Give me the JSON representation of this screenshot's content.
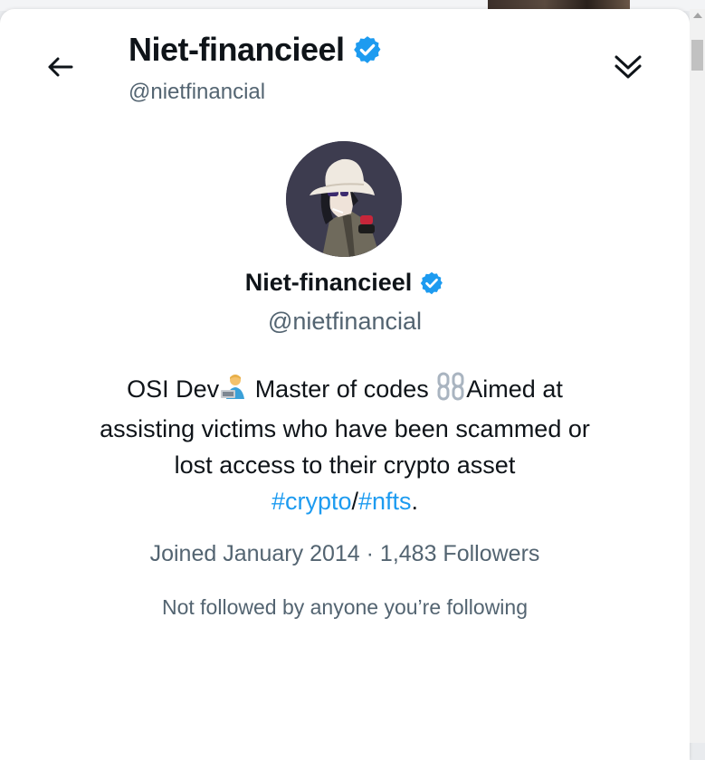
{
  "header": {
    "back_label": "Back",
    "name": "Niet-financieel",
    "handle": "@nietfinancial",
    "collapse_label": "Collapse"
  },
  "profile": {
    "name": "Niet-financieel",
    "handle": "@nietfinancial",
    "verified": true,
    "bio": {
      "part1": "OSI Dev",
      "part2": " Master of codes ",
      "part3": "Aimed at",
      "line2": "assisting victims who have been scammed or",
      "line3": "lost access to their crypto asset",
      "hashtag1": "#crypto",
      "separator": "/",
      "hashtag2": "#nfts",
      "end": "."
    },
    "joined": "Joined January 2014",
    "dot": " · ",
    "followers": "1,483 Followers",
    "followed_by": "Not followed by anyone you’re following"
  },
  "icons": {
    "back": "arrow-left-icon",
    "collapse": "double-chevron-down-icon",
    "verified": "verified-badge-icon",
    "technologist": "technologist-emoji-icon",
    "chain": "chain-emoji-icon"
  },
  "colors": {
    "accent": "#1d9bf0",
    "text": "#0f1419",
    "secondary": "#536471",
    "avatar_bg": "#3d3c4f"
  }
}
